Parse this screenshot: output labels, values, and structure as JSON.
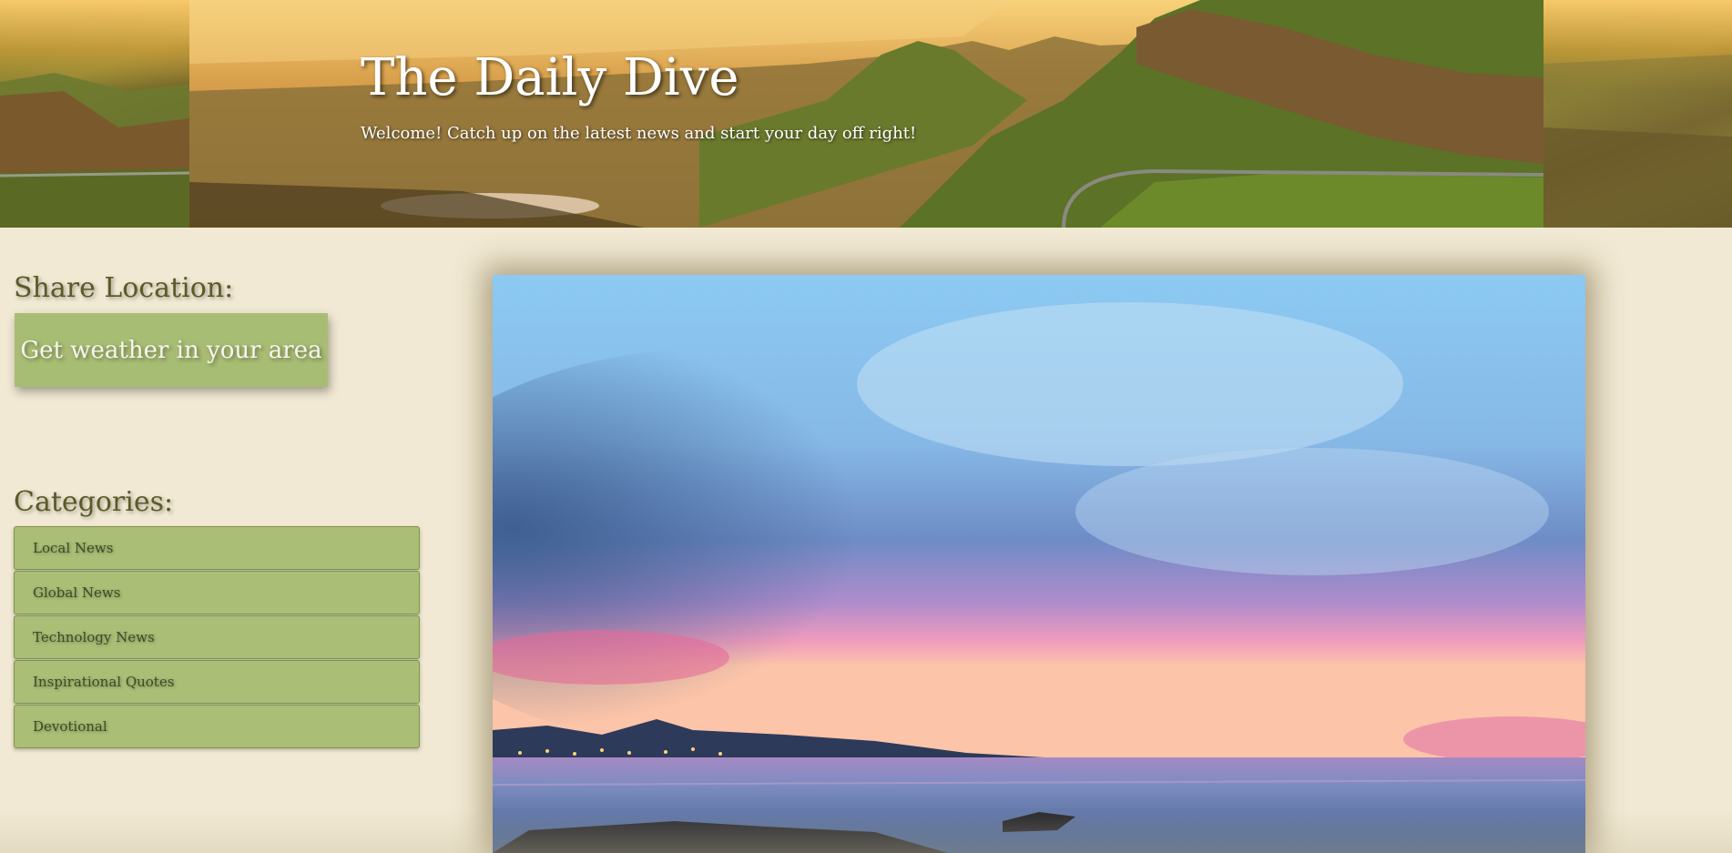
{
  "header": {
    "title": "The Daily Dive",
    "tagline": "Welcome! Catch up on the latest news and start your day off right!"
  },
  "location": {
    "heading": "Share Location:",
    "button_label": "Get weather in your area"
  },
  "categories": {
    "heading": "Categories:",
    "items": [
      {
        "label": "Local News"
      },
      {
        "label": "Global News"
      },
      {
        "label": "Technology News"
      },
      {
        "label": "Inspirational Quotes"
      },
      {
        "label": "Devotional"
      }
    ]
  },
  "colors": {
    "page_background": "#f1e9d3",
    "button_green": "#a8bd74",
    "heading_olive": "#5a5a28"
  }
}
